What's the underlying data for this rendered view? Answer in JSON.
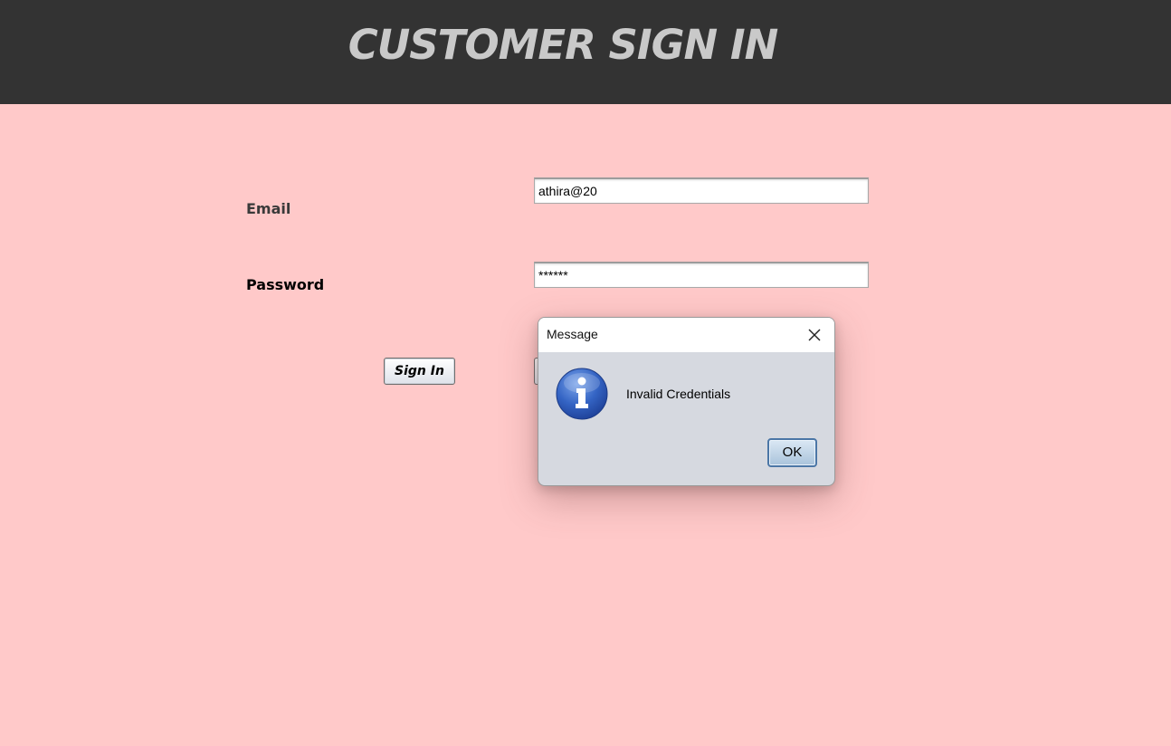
{
  "header": {
    "title": "CUSTOMER SIGN IN"
  },
  "form": {
    "email_label": "Email",
    "email_value": "athira@20",
    "password_label": "Password",
    "password_value": "******",
    "signin_label": "Sign In"
  },
  "dialog": {
    "title": "Message",
    "message": "Invalid Credentials",
    "ok_label": "OK",
    "icon": "info-icon",
    "close_icon": "close-icon"
  },
  "colors": {
    "background": "#ffc9c9",
    "header_bg": "#333333",
    "header_text": "#c9c9c9",
    "dialog_bg": "#d6d9e0",
    "info_icon_blue": "#2f5fb8"
  }
}
